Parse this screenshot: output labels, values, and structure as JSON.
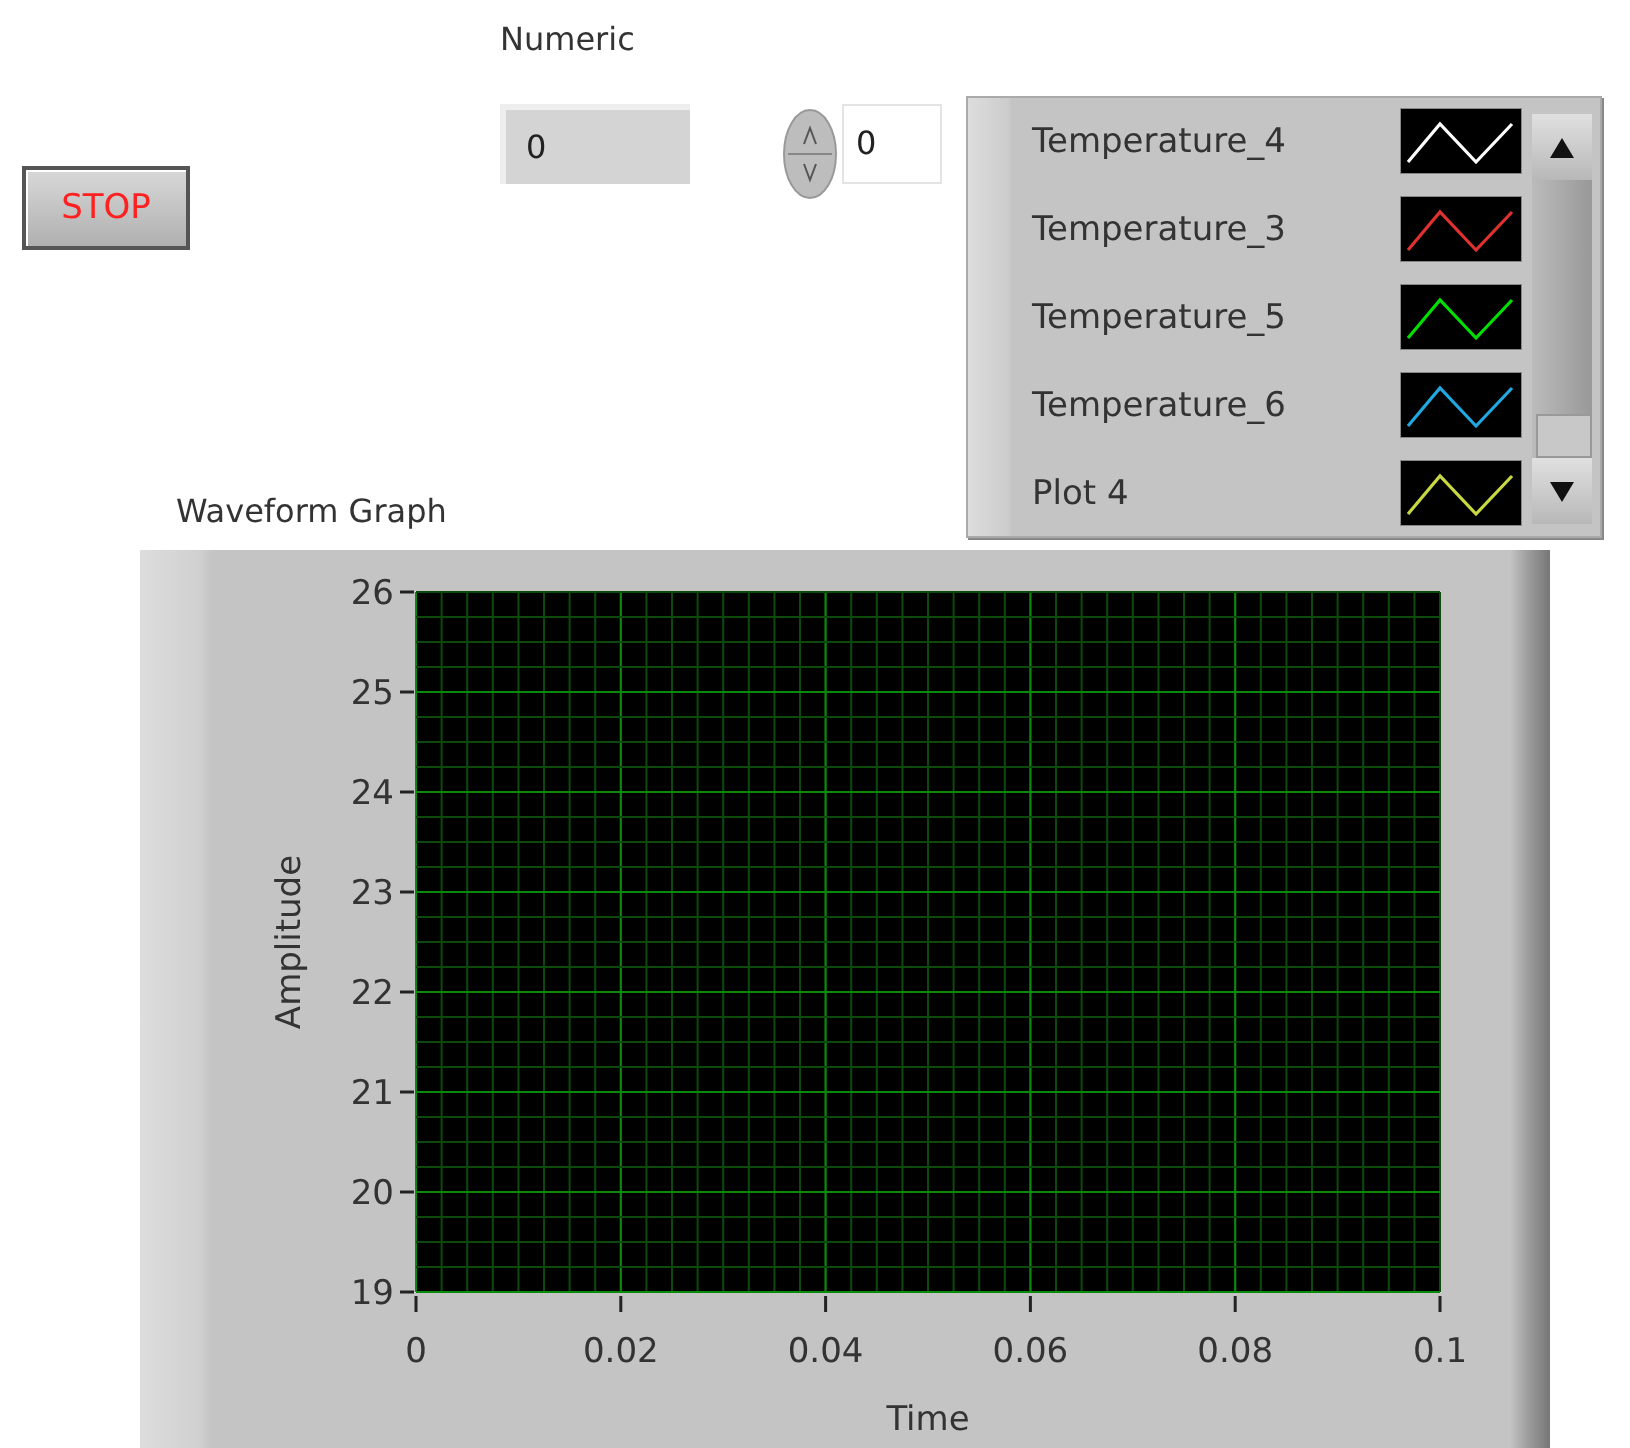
{
  "stop_button": {
    "label": "STOP"
  },
  "numeric_indicator": {
    "label": "Numeric",
    "value": "0"
  },
  "numeric_control": {
    "value": "0"
  },
  "legend": {
    "items": [
      {
        "name": "Temperature_4",
        "color": "#ffffff"
      },
      {
        "name": "Temperature_3",
        "color": "#e03030"
      },
      {
        "name": "Temperature_5",
        "color": "#00e000"
      },
      {
        "name": "Temperature_6",
        "color": "#20a8e0"
      },
      {
        "name": "Plot 4",
        "color": "#c8d840"
      }
    ]
  },
  "graph": {
    "chart_data": {
      "type": "line",
      "grid": true,
      "title": "Waveform Graph",
      "xlabel": "Time",
      "ylabel": "Amplitude",
      "xlim": [
        0,
        0.1
      ],
      "ylim": [
        19,
        26
      ],
      "xticks": [
        {
          "value": 0,
          "label": "0"
        },
        {
          "value": 0.02,
          "label": "0.02"
        },
        {
          "value": 0.04,
          "label": "0.04"
        },
        {
          "value": 0.06,
          "label": "0.06"
        },
        {
          "value": 0.08,
          "label": "0.08"
        },
        {
          "value": 0.1,
          "label": "0.1"
        }
      ],
      "yticks": [
        {
          "value": 19,
          "label": "19"
        },
        {
          "value": 20,
          "label": "20"
        },
        {
          "value": 21,
          "label": "21"
        },
        {
          "value": 22,
          "label": "22"
        },
        {
          "value": 23,
          "label": "23"
        },
        {
          "value": 24,
          "label": "24"
        },
        {
          "value": 25,
          "label": "25"
        },
        {
          "value": 26,
          "label": "26"
        }
      ]
    }
  }
}
